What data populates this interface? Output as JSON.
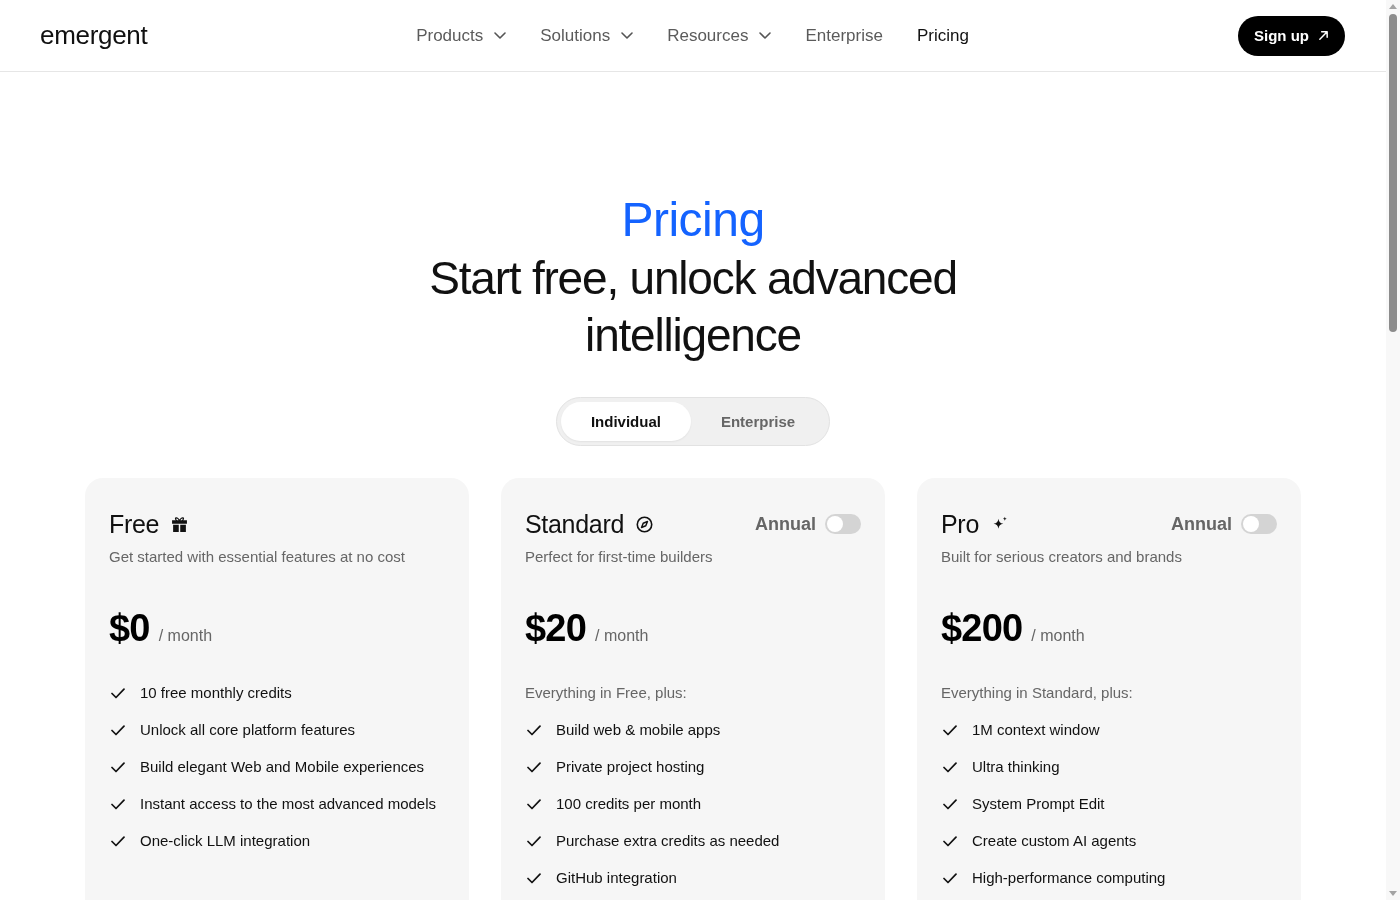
{
  "header": {
    "logo": "emergent",
    "nav": [
      {
        "label": "Products",
        "kind": "menu",
        "selected": false
      },
      {
        "label": "Solutions",
        "kind": "menu",
        "selected": false
      },
      {
        "label": "Resources",
        "kind": "menu",
        "selected": false
      },
      {
        "label": "Enterprise",
        "kind": "link",
        "selected": false
      },
      {
        "label": "Pricing",
        "kind": "link",
        "selected": true
      }
    ],
    "signup_button": "Sign up"
  },
  "hero": {
    "eyebrow": "Pricing",
    "headline": "Start free, unlock advanced intelligence"
  },
  "plan_tabs": [
    {
      "label": "Individual",
      "selected": true
    },
    {
      "label": "Enterprise",
      "selected": false
    }
  ],
  "plans": [
    {
      "name": "Free",
      "description": "Get started with essential features at no cost",
      "price": "$0",
      "period": "/ month",
      "features": [
        "10 free monthly credits",
        "Unlock all core platform features",
        "Build elegant Web and Mobile experiences",
        "Instant access to the most advanced models",
        "One-click LLM integration"
      ]
    },
    {
      "name": "Standard",
      "annual": {
        "label": "Annual",
        "on": false
      },
      "description": "Perfect for first-time builders",
      "price": "$20",
      "period": "/ month",
      "intro": "Everything in Free, plus:",
      "features": [
        "Build web & mobile apps",
        "Private project hosting",
        "100 credits per month",
        "Purchase extra credits as needed",
        "GitHub integration"
      ]
    },
    {
      "name": "Pro",
      "annual": {
        "label": "Annual",
        "on": false
      },
      "description": "Built for serious creators and brands",
      "price": "$200",
      "period": "/ month",
      "intro": "Everything in Standard, plus:",
      "features": [
        "1M context window",
        "Ultra thinking",
        "System Prompt Edit",
        "Create custom AI agents",
        "High-performance computing"
      ]
    }
  ]
}
